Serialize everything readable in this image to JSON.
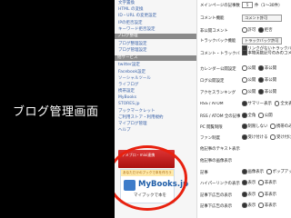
{
  "slide_title": "ブログ管理画面",
  "sidebar": {
    "items": [
      {
        "label": "文字置換",
        "kind": "link"
      },
      {
        "label": "HTML の変換",
        "kind": "link"
      },
      {
        "label": "ID・URL の変更設定",
        "kind": "link"
      },
      {
        "label": "IPの拒否設定",
        "kind": "link"
      },
      {
        "label": "キーワード拒否設定",
        "kind": "link"
      },
      {
        "label": "ブログ整理",
        "kind": "head"
      },
      {
        "label": "ブログ整理設定",
        "kind": "link"
      },
      {
        "label": "ブログ管理設定",
        "kind": "link"
      },
      {
        "label": "他サービス",
        "kind": "head"
      },
      {
        "label": "twitter設定",
        "kind": "link"
      },
      {
        "label": "Facebook設定",
        "kind": "link"
      },
      {
        "label": "ソーシャルツール",
        "kind": "link"
      },
      {
        "label": "ライフログ",
        "kind": "link"
      },
      {
        "label": "携帯設定",
        "kind": "link"
      },
      {
        "label": "MyBooks",
        "kind": "link"
      },
      {
        "label": "STORES.jp",
        "kind": "link"
      },
      {
        "label": "ブックマークレット",
        "kind": "link"
      },
      {
        "label": "ご利用ストア・利用規約",
        "kind": "link"
      },
      {
        "label": "マイブログ管理",
        "kind": "link"
      },
      {
        "label": "ヘルプ",
        "kind": "link"
      }
    ],
    "banner_text": "アメブロ・mixi連携",
    "mybooks": {
      "strip": "あなただけのブックで本を作ろう",
      "title": "MyBooks.jp",
      "subtitle": "マイブックで本を"
    }
  },
  "settings": [
    {
      "label": "メインページの記事数",
      "value": "5",
      "suffix": "件（1〜30件）",
      "type": "field"
    },
    {
      "label": "コメント機能",
      "select": "コメント許可",
      "type": "select"
    },
    {
      "label": "非公開コメント",
      "options": [
        "許可",
        "拒否"
      ],
      "selected": 1,
      "type": "radio"
    },
    {
      "label": "トラックバック機能",
      "select": "トラックバック許可",
      "note": "リンクがないトラックバックを受け付けない",
      "type": "select"
    },
    {
      "label": "コメント・トラックバック先",
      "note": "本物英数記号のみのコメント・トラックバック",
      "type": "check"
    },
    {
      "label": "カレンダー公開設定",
      "options": [
        "公開",
        "非公開"
      ],
      "selected": 1,
      "type": "radio"
    },
    {
      "label": "ログ公開設定",
      "options": [
        "公開",
        "非公開"
      ],
      "selected": 1,
      "type": "radio"
    },
    {
      "label": "アクセスランキング",
      "options": [
        "公開",
        "非公開"
      ],
      "selected": 1,
      "type": "radio"
    },
    {
      "label": "RSS / ATOM",
      "options": [
        "サマリー表示",
        "全文表示"
      ],
      "selected": 0,
      "type": "radio"
    },
    {
      "label": "RSS / ATOM 全の記事",
      "options": [
        "全角",
        "公開"
      ],
      "selected": 0,
      "type": "radio"
    },
    {
      "label": "PC 閲覧制限",
      "options": [
        "制限しない",
        "携帯のみの閲覧"
      ],
      "selected": 0,
      "type": "radio"
    },
    {
      "label": "ファン制度",
      "options": [
        "受け付ける",
        "受け付けない"
      ],
      "selected": 0,
      "type": "radio"
    },
    {
      "label": "他記事のテキスト表示",
      "options": [],
      "type": "none"
    },
    {
      "label": "他記事の画像表示",
      "options": [],
      "type": "none"
    },
    {
      "label": "記事",
      "options": [
        "画像表示",
        "ポップアップ"
      ],
      "selected": 0,
      "type": "radio"
    },
    {
      "label": "ハイパーリンクの表示",
      "options": [
        "表示",
        "非表示"
      ],
      "selected": 0,
      "type": "radio"
    },
    {
      "label": "記事下広告の表示",
      "options": [
        "表示",
        "非表示"
      ],
      "selected": 0,
      "type": "radio"
    },
    {
      "label": "記事下広告の表示",
      "options": [
        "表示",
        "非表示"
      ],
      "selected": 0,
      "type": "radio"
    }
  ]
}
